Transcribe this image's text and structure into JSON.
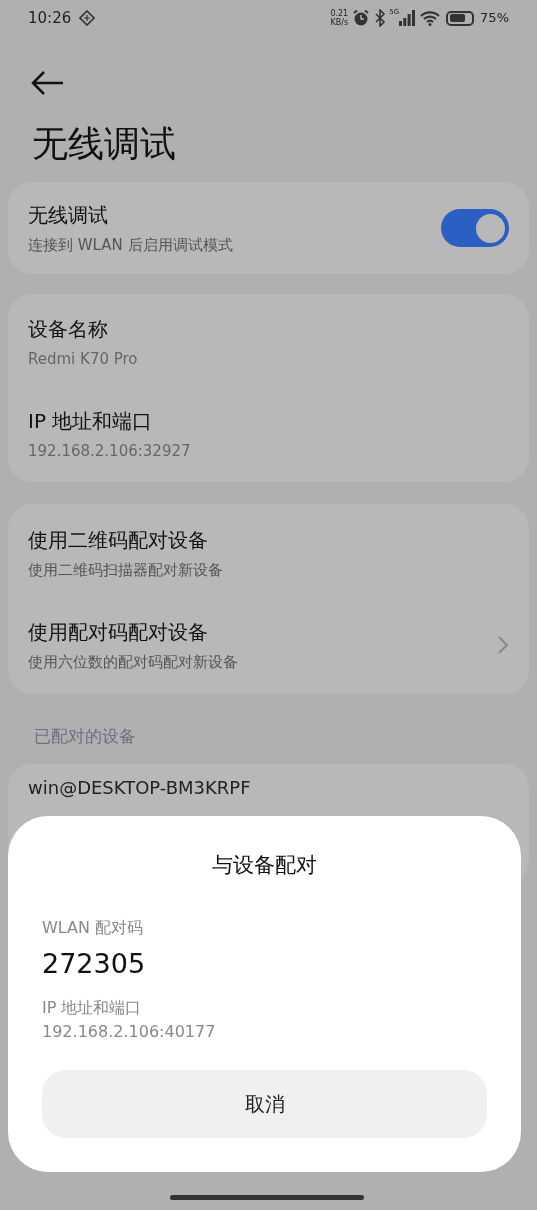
{
  "status_bar": {
    "time": "10:26",
    "net_speed": "0.21",
    "net_unit": "KB/s",
    "network": "5G",
    "battery": "75%"
  },
  "title": "无线调试",
  "toggle": {
    "title": "无线调试",
    "subtitle": "连接到 WLAN 后启用调试模式",
    "on": true
  },
  "info": [
    {
      "title": "设备名称",
      "value": "Redmi K70 Pro"
    },
    {
      "title": "IP 地址和端口",
      "value": "192.168.2.106:32927"
    }
  ],
  "pair_options": [
    {
      "title": "使用二维码配对设备",
      "subtitle": "使用二维码扫描器配对新设备",
      "chevron": false
    },
    {
      "title": "使用配对码配对设备",
      "subtitle": "使用六位数的配对码配对新设备",
      "chevron": true
    }
  ],
  "paired_section": {
    "label": "已配对的设备",
    "devices": [
      "win@DESKTOP-BM3KRPF"
    ]
  },
  "dialog": {
    "title": "与设备配对",
    "code_label": "WLAN 配对码",
    "code": "272305",
    "ip_label": "IP 地址和端口",
    "ip": "192.168.2.106:40177",
    "cancel": "取消"
  }
}
